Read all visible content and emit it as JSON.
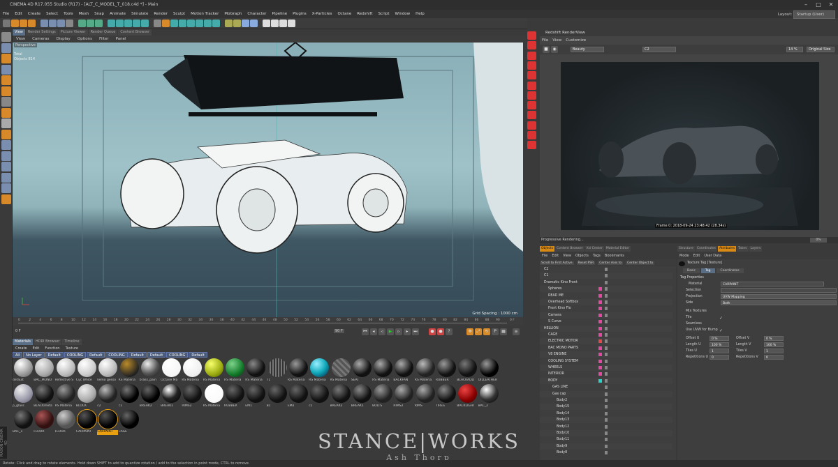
{
  "window": {
    "title": "CINEMA 4D R17.055 Studio (R17) - [ALT_C_MODEL_T_018.c4d *] - Main",
    "layout_label": "Layout:",
    "layout_value": "Startup (User)"
  },
  "menu": [
    "File",
    "Edit",
    "Create",
    "Select",
    "Tools",
    "Mesh",
    "Snap",
    "Animate",
    "Simulate",
    "Render",
    "Sculpt",
    "Motion Tracker",
    "MoGraph",
    "Character",
    "Pipeline",
    "Plugins",
    "X-Particles",
    "Octane",
    "Redshift",
    "Script",
    "Window",
    "Help"
  ],
  "viewport": {
    "tabs": [
      "View",
      "Render Settings",
      "Picture Viewer",
      "Render Queue",
      "Content Browser"
    ],
    "menu": [
      "View",
      "Cameras",
      "Display",
      "Options",
      "Filter",
      "Panel"
    ],
    "camera_label": "Perspective",
    "stats_total": "Total",
    "stats_objects": "Objects  814",
    "grid_spacing": "Grid Spacing : 1000 cm"
  },
  "timeline": {
    "ticks": [
      "0",
      "2",
      "4",
      "6",
      "8",
      "10",
      "12",
      "14",
      "16",
      "18",
      "20",
      "22",
      "24",
      "26",
      "28",
      "30",
      "32",
      "34",
      "36",
      "38",
      "40",
      "42",
      "44",
      "46",
      "48",
      "50",
      "52",
      "54",
      "56",
      "58",
      "60",
      "62",
      "64",
      "66",
      "68",
      "70",
      "72",
      "74",
      "76",
      "78",
      "80",
      "82",
      "84",
      "86",
      "88",
      "90"
    ],
    "end_label": "0 F",
    "current_frame": "0 F",
    "end_frame": "90 F"
  },
  "materials": {
    "tabs": [
      "Materials",
      "HDRI Browser",
      "Timeline"
    ],
    "menu": [
      "Create",
      "Edit",
      "Function",
      "Texture"
    ],
    "filters": [
      "All",
      "No Layer",
      "Default",
      "COOLING",
      "Default",
      "COOLING",
      "Default",
      "Default",
      "COOLING",
      "Default"
    ],
    "row1": [
      "default",
      "BAC_MONO",
      "Reflective S",
      "Cyc White",
      "kemo gesso",
      "RS Materia",
      "brass_pain",
      "Octane Ma",
      "RS Materia",
      "RS Materia",
      "RS Materia",
      "RS Materia",
      "T1",
      "RS Materia",
      "RS Materia",
      "RS Materia",
      "SEAT",
      "RS Materia",
      "BACKFAN",
      "RS Materia",
      "RUBBER",
      "BLACKADD",
      "OILLEATHER"
    ],
    "row2": [
      "p_glass",
      "BLACKmeta",
      "RS Materia",
      "BLOCK",
      "c2",
      "c1",
      "BREAK2",
      "BREAK1",
      "RIMS2",
      "RS Materia",
      "RUBBER",
      "EM1",
      "B1",
      "EM2",
      "c1",
      "BREAK2",
      "BREAK1",
      "BOLTS",
      "RIMS2",
      "RIMS",
      "TIRES",
      "BACKLIGHT",
      "BAC_2"
    ],
    "row3": [
      "BAC_1",
      "FLOOR",
      "FLOOR",
      "CARPAINT",
      "CARPAINT",
      "CAGE"
    ]
  },
  "redshift": {
    "title": "Redshift RenderView",
    "menu": [
      "File",
      "View",
      "Customize"
    ],
    "aov": "Beauty",
    "camera": "C2",
    "zoom": "14 %",
    "size": "Original Size",
    "frame_stamp": "Frame  0:  2018-09-24  23:48:42  (28.34s)",
    "progress": "Progressive Rendering..."
  },
  "objects": {
    "tabs": [
      "Objects",
      "Content Browser",
      "Xsi Center",
      "Material Editor"
    ],
    "menu": [
      "File",
      "Edit",
      "View",
      "Objects",
      "Tags",
      "Bookmarks"
    ],
    "toolbar": [
      "Scroll to First Active",
      "Reset PSR",
      "Center Axis to",
      "Center Object to"
    ],
    "rows": [
      {
        "name": "C2",
        "indent": 0,
        "color": ""
      },
      {
        "name": "C1",
        "indent": 0,
        "color": ""
      },
      {
        "name": "Dramatic Kino Front",
        "indent": 0,
        "color": ""
      },
      {
        "name": "Spheres",
        "indent": 1,
        "color": "#e04aa0"
      },
      {
        "name": "READ ME",
        "indent": 1,
        "color": "#e04aa0"
      },
      {
        "name": "Overhead Softbox",
        "indent": 1,
        "color": "#e04aa0"
      },
      {
        "name": "Front Kino Flo",
        "indent": 1,
        "color": "#e04aa0"
      },
      {
        "name": "Camera",
        "indent": 1,
        "color": "#e04aa0"
      },
      {
        "name": "S Curve",
        "indent": 1,
        "color": "#e04aa0"
      },
      {
        "name": "HELLION",
        "indent": 0,
        "color": "#e04aa0"
      },
      {
        "name": "CAGE",
        "indent": 1,
        "color": "#e04aa0"
      },
      {
        "name": "ELECTRIC MOTOR",
        "indent": 1,
        "color": "#e04a4a"
      },
      {
        "name": "BAC MONO PARTS",
        "indent": 1,
        "color": "#e04aa0"
      },
      {
        "name": "V8 ENGINE",
        "indent": 1,
        "color": "#e04aa0"
      },
      {
        "name": "COOLING SYSTEM",
        "indent": 1,
        "color": "#e04aa0"
      },
      {
        "name": "WHEELS",
        "indent": 1,
        "color": "#e04aa0"
      },
      {
        "name": "INTERIOR",
        "indent": 1,
        "color": "#e04aa0"
      },
      {
        "name": "BODY",
        "indent": 1,
        "color": "#2ad3c8"
      },
      {
        "name": "GAS LINE",
        "indent": 2,
        "color": ""
      },
      {
        "name": "Gas cap",
        "indent": 2,
        "color": ""
      },
      {
        "name": "Body2",
        "indent": 3,
        "color": ""
      },
      {
        "name": "Body15",
        "indent": 3,
        "color": ""
      },
      {
        "name": "Body14",
        "indent": 3,
        "color": ""
      },
      {
        "name": "Body13",
        "indent": 3,
        "color": ""
      },
      {
        "name": "Body12",
        "indent": 3,
        "color": ""
      },
      {
        "name": "Body10",
        "indent": 3,
        "color": ""
      },
      {
        "name": "Body11",
        "indent": 3,
        "color": ""
      },
      {
        "name": "Body9",
        "indent": 3,
        "color": ""
      },
      {
        "name": "Body8",
        "indent": 3,
        "color": ""
      }
    ]
  },
  "attributes": {
    "tabs": [
      "Structure",
      "Coordinates",
      "Attributes",
      "Takes",
      "Layers"
    ],
    "menu": [
      "Mode",
      "Edit",
      "User Data"
    ],
    "header": "Texture Tag [Texture]",
    "subtabs": [
      "Basic",
      "Tag",
      "Coordinates"
    ],
    "section": "Tag Properties",
    "material_label": "Material",
    "material_value": "CARPAINT",
    "selection_label": "Selection",
    "projection_label": "Projection",
    "projection_value": "UVW Mapping",
    "side_label": "Side",
    "side_value": "Both",
    "mix_label": "Mix Textures",
    "tile_label": "Tile",
    "seamless_label": "Seamless",
    "uvw_bump_label": "Use UVW for Bump",
    "offset_u_label": "Offset U",
    "offset_u": "0 %",
    "offset_v_label": "Offset V",
    "offset_v": "0 %",
    "length_u_label": "Length U",
    "length_u": "100 %",
    "length_v_label": "Length V",
    "length_v": "100 %",
    "tiles_u_label": "Tiles U",
    "tiles_u": "1",
    "tiles_v_label": "Tiles V",
    "tiles_v": "1",
    "rep_u_label": "Repetitions U",
    "rep_u": "0",
    "rep_v_label": "Repetitions V",
    "rep_v": "0"
  },
  "watermark": {
    "brand": "STANCE|WORKS",
    "author": "Ash Thorp"
  },
  "maxon": "MAXON CINEMA 4D",
  "status": "Rotate: Click and drag to rotate elements. Hold down SHIFT to add to quantize rotation / add to the selection in point mode, CTRL to remove."
}
